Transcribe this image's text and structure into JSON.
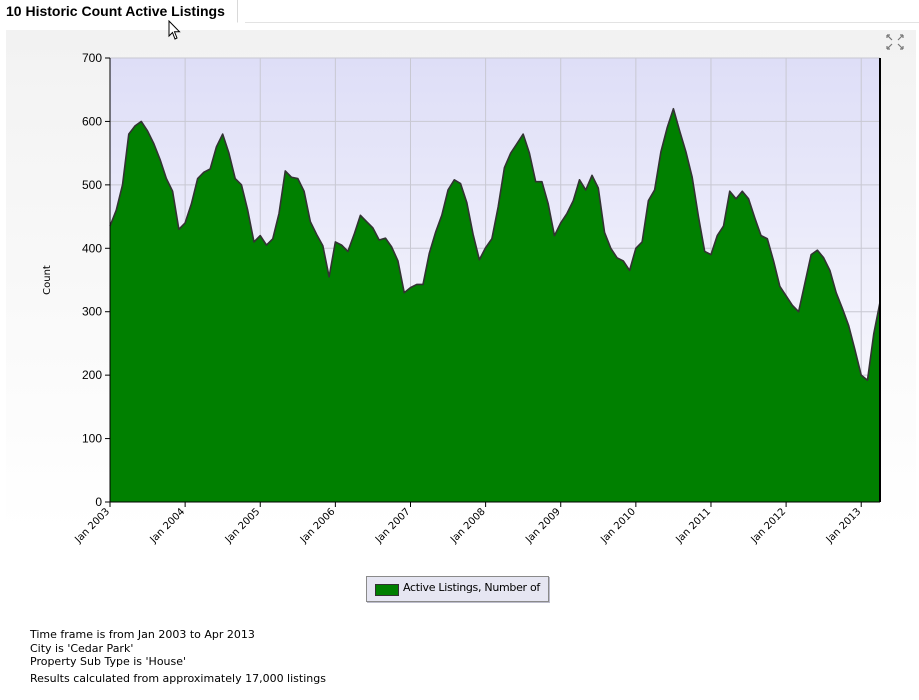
{
  "tab": {
    "title": "10 Historic Count Active Listings"
  },
  "toolbar": {
    "expand_icon": "expand-arrows-icon"
  },
  "chart_data": {
    "type": "area",
    "title": "",
    "xlabel": "",
    "ylabel": "Count",
    "ylim": [
      0,
      700
    ],
    "yticks": [
      "0",
      "100",
      "200",
      "300",
      "400",
      "500",
      "600",
      "700"
    ],
    "xticks": [
      "Jan 2003",
      "Jan 2004",
      "Jan 2005",
      "Jan 2006",
      "Jan 2007",
      "Jan 2008",
      "Jan 2009",
      "Jan 2010",
      "Jan 2011",
      "Jan 2012",
      "Jan 2013"
    ],
    "xstart": "Jan 2003",
    "xend": "Apr 2013",
    "grid": true,
    "legend_position": "bottom-center",
    "colors": {
      "fill": "#008000",
      "line": "#333333",
      "plot_bg_top": "#dedef7",
      "plot_bg_bottom": "#ffffff"
    },
    "series": [
      {
        "name": "Active Listings, Number of",
        "values": [
          435,
          460,
          500,
          580,
          593,
          600,
          585,
          565,
          540,
          510,
          490,
          430,
          440,
          470,
          510,
          520,
          525,
          560,
          580,
          550,
          510,
          500,
          460,
          410,
          420,
          405,
          415,
          455,
          522,
          512,
          510,
          490,
          442,
          422,
          404,
          355,
          410,
          405,
          395,
          422,
          452,
          442,
          432,
          413,
          416,
          402,
          380,
          330,
          338,
          343,
          343,
          392,
          425,
          452,
          492,
          508,
          502,
          472,
          422,
          382,
          401,
          415,
          465,
          527,
          550,
          565,
          580,
          550,
          505,
          505,
          470,
          420,
          440,
          455,
          475,
          508,
          492,
          515,
          495,
          425,
          400,
          385,
          380,
          365,
          400,
          410,
          475,
          492,
          552,
          590,
          620,
          585,
          552,
          512,
          450,
          395,
          390,
          420,
          435,
          490,
          478,
          490,
          478,
          448,
          420,
          415,
          380,
          340,
          325,
          310,
          300,
          345,
          390,
          397,
          385,
          365,
          330,
          305,
          278,
          240,
          200,
          192,
          265,
          315
        ]
      }
    ]
  },
  "legend": {
    "label": "Active Listings, Number of"
  },
  "notes": {
    "timeframe": "Time frame is from Jan 2003 to Apr 2013",
    "city": "City is 'Cedar Park'",
    "subtype": "Property Sub Type is 'House'",
    "results": "Results calculated from approximately 17,000 listings"
  }
}
